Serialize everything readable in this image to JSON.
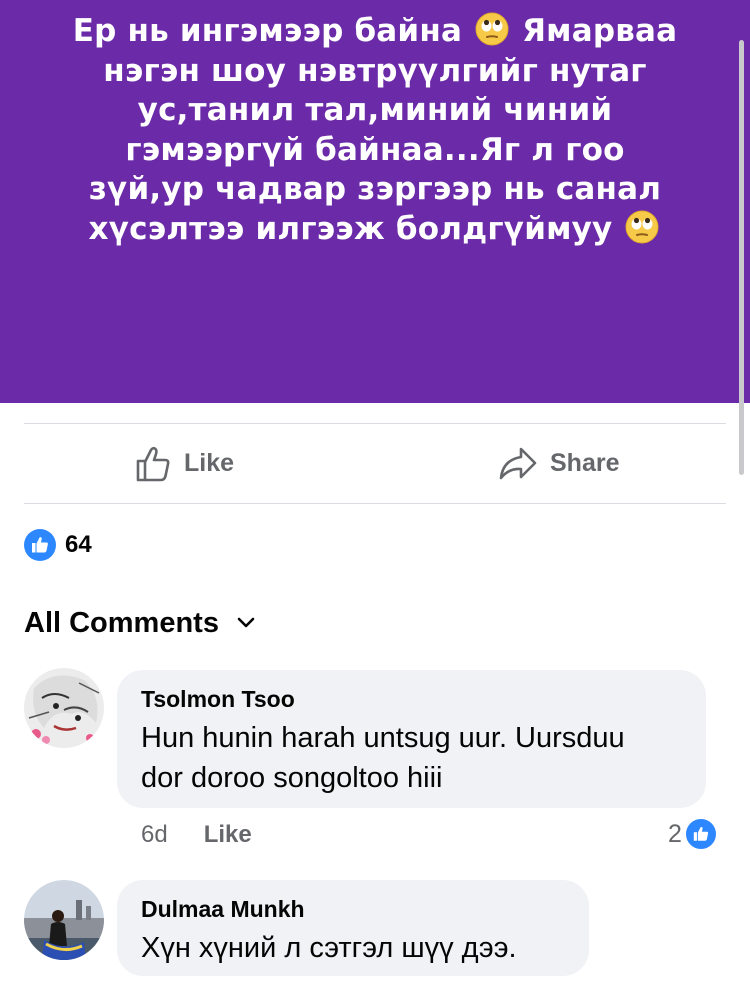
{
  "post": {
    "text_lines": [
      "Ер нь ингэмээр байна",
      "Ямарваа",
      "нэгэн шоу нэвтрүүлгийг нутаг",
      "ус,танил тал,миний чиний",
      "гэмээргүй байнаа...Яг л гоо",
      "зүй,ур чадвар зэргээр нь санал",
      "хүсэлтээ илгээж болдгүймуу"
    ],
    "background_color": "#6b2aa8",
    "emoji_icon": "face-with-rolling-eyes-icon"
  },
  "actions": {
    "like_label": "Like",
    "share_label": "Share"
  },
  "reactions": {
    "count": "64"
  },
  "comments_section": {
    "title": "All Comments"
  },
  "comments": [
    {
      "author": "Tsolmon Tsoo",
      "text_lines": [
        "Hun hunin harah untsug uur. Uursduu",
        "dor doroo songoltoo hiii"
      ],
      "time": "6d",
      "like_label": "Like",
      "likes": "2"
    },
    {
      "author": "Dulmaa Munkh",
      "text_lines": [
        "Хүн хүний л сэтгэл шүү дээ."
      ]
    }
  ],
  "colors": {
    "accent": "#2d88ff",
    "muted_text": "#65676b",
    "bubble": "#f0f2f5"
  }
}
